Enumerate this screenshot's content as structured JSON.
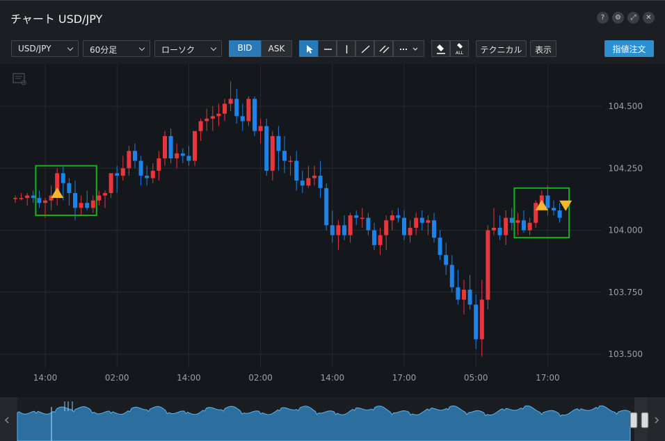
{
  "window": {
    "title": "チャート USD/JPY"
  },
  "window_buttons": [
    "?",
    "⚙",
    "⤢",
    "✕"
  ],
  "toolbar": {
    "pair": "USD/JPY",
    "timeframe": "60分足",
    "chart_style": "ローソク",
    "bid_label": "BID",
    "ask_label": "ASK",
    "all_label": "ALL",
    "technical_label": "テクニカル",
    "display_label": "表示",
    "limit_order_label": "指値注文"
  },
  "colors": {
    "up": "#e8363c",
    "down": "#1f82e6",
    "marker": "#f5b72d",
    "highlight": "#17b21f",
    "accent": "#2d8fd0"
  },
  "chart_data": {
    "type": "candlestick",
    "title": "",
    "price_side": "BID",
    "y_ticks": [
      104.5,
      104.25,
      104.0,
      103.75,
      103.5
    ],
    "y_tick_labels": [
      "104.500",
      "104.250",
      "104.000",
      "103.750",
      "103.500"
    ],
    "ylim": [
      103.45,
      104.65
    ],
    "x_ticks": [
      "14:00",
      "02:00",
      "14:00",
      "02:00",
      "14:00",
      "17:00",
      "05:00",
      "17:00"
    ],
    "x_tick_positions": [
      5,
      17,
      29,
      41,
      53,
      65,
      77,
      89
    ],
    "grid": true,
    "candles": [
      [
        104.13,
        104.14,
        104.11,
        104.13
      ],
      [
        104.13,
        104.15,
        104.12,
        104.13
      ],
      [
        104.13,
        104.15,
        104.1,
        104.14
      ],
      [
        104.14,
        104.16,
        104.11,
        104.13
      ],
      [
        104.13,
        104.16,
        104.09,
        104.11
      ],
      [
        104.11,
        104.13,
        104.05,
        104.12
      ],
      [
        104.12,
        104.18,
        104.08,
        104.14
      ],
      [
        104.14,
        104.25,
        104.1,
        104.23
      ],
      [
        104.23,
        104.26,
        104.12,
        104.19
      ],
      [
        104.19,
        104.21,
        104.1,
        104.15
      ],
      [
        104.15,
        104.2,
        104.04,
        104.09
      ],
      [
        104.09,
        104.14,
        104.06,
        104.11
      ],
      [
        104.11,
        104.16,
        104.08,
        104.09
      ],
      [
        104.09,
        104.14,
        104.07,
        104.12
      ],
      [
        104.12,
        104.16,
        104.1,
        104.14
      ],
      [
        104.14,
        104.16,
        104.09,
        104.15
      ],
      [
        104.15,
        104.22,
        104.13,
        104.23
      ],
      [
        104.23,
        104.26,
        104.15,
        104.22
      ],
      [
        104.22,
        104.3,
        104.2,
        104.25
      ],
      [
        104.25,
        104.34,
        104.22,
        104.32
      ],
      [
        104.32,
        104.35,
        104.25,
        104.28
      ],
      [
        104.28,
        104.3,
        104.18,
        104.22
      ],
      [
        104.22,
        104.26,
        104.18,
        104.21
      ],
      [
        104.21,
        104.27,
        104.19,
        104.24
      ],
      [
        104.24,
        104.32,
        104.2,
        104.29
      ],
      [
        104.29,
        104.4,
        104.26,
        104.38
      ],
      [
        104.38,
        104.41,
        104.27,
        104.29
      ],
      [
        104.29,
        104.35,
        104.25,
        104.31
      ],
      [
        104.31,
        104.33,
        104.27,
        104.3
      ],
      [
        104.3,
        104.34,
        104.26,
        104.28
      ],
      [
        104.28,
        104.4,
        104.26,
        104.4
      ],
      [
        104.4,
        104.45,
        104.36,
        104.44
      ],
      [
        104.44,
        104.49,
        104.4,
        104.45
      ],
      [
        104.45,
        104.5,
        104.4,
        104.46
      ],
      [
        104.46,
        104.51,
        104.42,
        104.47
      ],
      [
        104.47,
        104.53,
        104.44,
        104.51
      ],
      [
        104.51,
        104.6,
        104.48,
        104.53
      ],
      [
        104.53,
        104.57,
        104.43,
        104.46
      ],
      [
        104.46,
        104.51,
        104.4,
        104.44
      ],
      [
        104.44,
        104.54,
        104.42,
        104.53
      ],
      [
        104.53,
        104.54,
        104.38,
        104.4
      ],
      [
        104.4,
        104.45,
        104.35,
        104.42
      ],
      [
        104.42,
        104.45,
        104.22,
        104.24
      ],
      [
        104.24,
        104.4,
        104.2,
        104.38
      ],
      [
        104.38,
        104.42,
        104.24,
        104.32
      ],
      [
        104.32,
        104.38,
        104.23,
        104.28
      ],
      [
        104.28,
        104.3,
        104.22,
        104.28
      ],
      [
        104.28,
        104.32,
        104.16,
        104.2
      ],
      [
        104.2,
        104.24,
        104.15,
        104.18
      ],
      [
        104.18,
        104.26,
        104.17,
        104.21
      ],
      [
        104.21,
        104.26,
        104.18,
        104.22
      ],
      [
        104.22,
        104.28,
        104.13,
        104.17
      ],
      [
        104.17,
        104.19,
        104.0,
        104.02
      ],
      [
        104.02,
        104.08,
        103.95,
        103.98
      ],
      [
        103.98,
        104.04,
        103.92,
        104.02
      ],
      [
        104.02,
        104.06,
        103.96,
        103.98
      ],
      [
        103.98,
        104.07,
        103.95,
        104.06
      ],
      [
        104.06,
        104.08,
        104.02,
        104.05
      ],
      [
        104.05,
        104.09,
        104.01,
        104.05
      ],
      [
        104.05,
        104.07,
        103.98,
        104.0
      ],
      [
        104.0,
        104.03,
        103.92,
        103.94
      ],
      [
        103.94,
        104.01,
        103.9,
        103.98
      ],
      [
        103.98,
        104.06,
        103.92,
        104.04
      ],
      [
        104.04,
        104.08,
        104.0,
        104.06
      ],
      [
        104.06,
        104.09,
        104.03,
        104.05
      ],
      [
        104.05,
        104.08,
        103.96,
        103.98
      ],
      [
        103.98,
        104.04,
        103.95,
        104.01
      ],
      [
        104.01,
        104.07,
        103.98,
        104.05
      ],
      [
        104.05,
        104.08,
        104.0,
        104.03
      ],
      [
        104.03,
        104.06,
        103.98,
        104.04
      ],
      [
        104.04,
        104.07,
        103.95,
        103.97
      ],
      [
        103.97,
        104.0,
        103.88,
        103.9
      ],
      [
        103.9,
        103.95,
        103.82,
        103.86
      ],
      [
        103.86,
        103.9,
        103.75,
        103.77
      ],
      [
        103.77,
        103.84,
        103.7,
        103.72
      ],
      [
        103.72,
        103.8,
        103.66,
        103.76
      ],
      [
        103.76,
        103.82,
        103.68,
        103.7
      ],
      [
        103.7,
        103.74,
        103.52,
        103.56
      ],
      [
        103.56,
        103.8,
        103.49,
        103.72
      ],
      [
        103.72,
        104.02,
        103.68,
        104.0
      ],
      [
        104.0,
        104.09,
        103.98,
        104.01
      ],
      [
        104.01,
        104.06,
        103.96,
        103.98
      ],
      [
        103.98,
        104.08,
        103.94,
        104.05
      ],
      [
        104.05,
        104.09,
        104.0,
        104.03
      ],
      [
        104.03,
        104.07,
        103.98,
        104.04
      ],
      [
        104.04,
        104.08,
        103.99,
        104.0
      ],
      [
        104.0,
        104.05,
        103.98,
        104.03
      ],
      [
        104.03,
        104.12,
        104.01,
        104.11
      ],
      [
        104.11,
        104.16,
        104.08,
        104.14
      ],
      [
        104.14,
        104.18,
        104.06,
        104.09
      ],
      [
        104.09,
        104.12,
        104.06,
        104.08
      ],
      [
        104.08,
        104.11,
        104.03,
        104.05
      ]
    ],
    "markers": [
      {
        "type": "buy",
        "index": 7,
        "price": 104.15
      },
      {
        "type": "buy",
        "index": 88,
        "price": 104.1
      },
      {
        "type": "sell",
        "index": 92,
        "price": 104.1
      }
    ]
  }
}
